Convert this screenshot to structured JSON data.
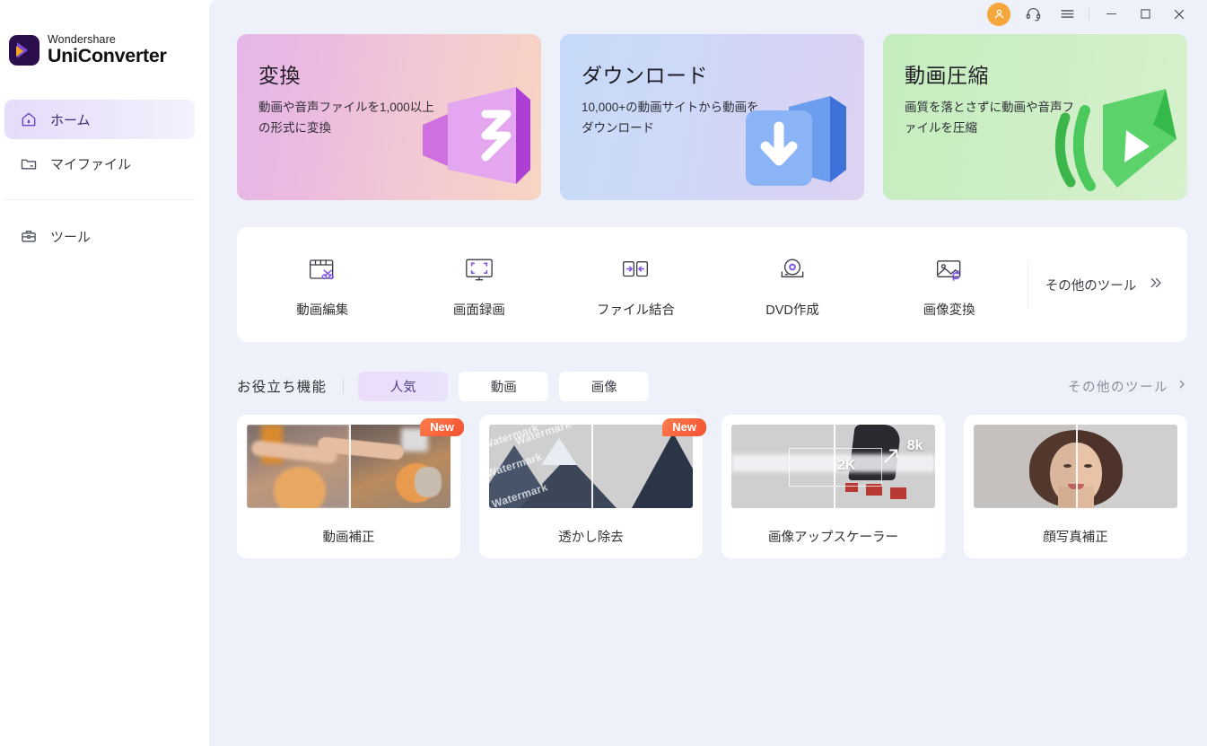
{
  "brand": {
    "line1": "Wondershare",
    "line2": "UniConverter",
    "logo_icon": "uniconverter-logo"
  },
  "sidebar": {
    "items": [
      {
        "label": "ホーム",
        "icon": "home-icon",
        "active": true
      },
      {
        "label": "マイファイル",
        "icon": "folder-icon",
        "active": false
      },
      {
        "label": "ツール",
        "icon": "toolbox-icon",
        "active": false
      }
    ]
  },
  "titlebar": {
    "account_icon": "user-avatar-icon",
    "support_icon": "headset-icon",
    "menu_icon": "hamburger-menu-icon",
    "minimize_icon": "minimize-icon",
    "maximize_icon": "maximize-icon",
    "close_icon": "close-icon"
  },
  "hero": {
    "cards": [
      {
        "title": "変換",
        "desc": "動画や音声ファイルを1,000以上の形式に変換",
        "art": "video-camera-3d-icon",
        "accent": "#d98fd6"
      },
      {
        "title": "ダウンロード",
        "desc": "10,000+の動画サイトから動画をダウンロード",
        "art": "download-3d-icon",
        "accent": "#4f87e8"
      },
      {
        "title": "動画圧縮",
        "desc": "画質を落とさずに動画や音声ファイルを圧縮",
        "art": "compress-3d-icon",
        "accent": "#49c14f"
      }
    ]
  },
  "tools": {
    "items": [
      {
        "label": "動画編集",
        "icon": "video-edit-scissors-icon"
      },
      {
        "label": "画面録画",
        "icon": "screen-record-monitor-icon"
      },
      {
        "label": "ファイル結合",
        "icon": "merge-files-icon"
      },
      {
        "label": "DVD作成",
        "icon": "dvd-burn-disc-icon"
      },
      {
        "label": "画像変換",
        "icon": "image-convert-icon"
      }
    ],
    "more_label": "その他のツール",
    "more_icon": "double-chevron-right-icon"
  },
  "section": {
    "title": "お役立ち機能",
    "tabs": [
      {
        "label": "人気",
        "active": true
      },
      {
        "label": "動画",
        "active": false
      },
      {
        "label": "画像",
        "active": false
      }
    ],
    "more_label": "その他のツール",
    "more_icon": "chevron-right-icon"
  },
  "features": {
    "badge_label": "New",
    "cards": [
      {
        "name": "動画補正",
        "badge": true,
        "thumb": "dog-before-after-thumb"
      },
      {
        "name": "透かし除去",
        "badge": true,
        "thumb": "mountain-watermark-thumb",
        "watermark_text": "Watermark"
      },
      {
        "name": "画像アップスケーラー",
        "badge": false,
        "thumb": "village-upscale-thumb",
        "tag_low": "2K",
        "tag_high": "8k"
      },
      {
        "name": "顔写真補正",
        "badge": false,
        "thumb": "portrait-before-after-thumb"
      }
    ]
  },
  "colors": {
    "app_bg": "#eef1f9",
    "panel": "#ffffff",
    "accent_purple": "#7b4dd6",
    "badge_orange": "#f3502f",
    "avatar_orange": "#f5a73c"
  }
}
